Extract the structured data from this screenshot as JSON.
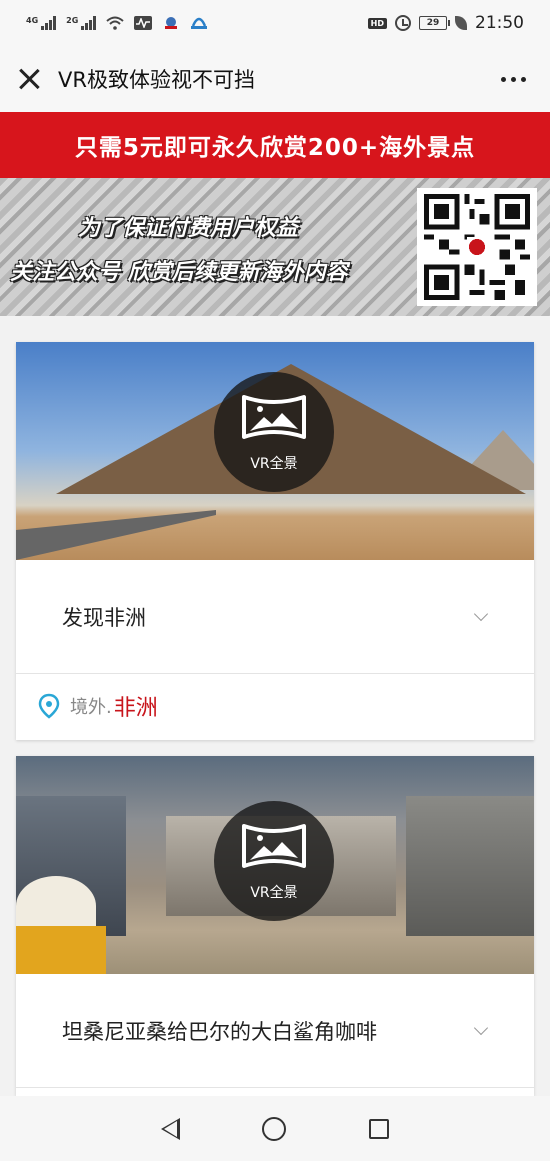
{
  "status_bar": {
    "network1": "4G",
    "network2": "2G",
    "hd": "HD",
    "battery": "29",
    "time": "21:50"
  },
  "title_bar": {
    "title": "VR极致体验视不可挡"
  },
  "promo": {
    "text": "只需5元即可永久欣赏200+海外景点"
  },
  "banner": {
    "line1": "为了保证付费用户权益",
    "line2": "关注公众号 欣赏后续更新海外内容"
  },
  "vr_badge_label": "VR全景",
  "cards": [
    {
      "title": "发现非洲",
      "loc_prefix": "境外.",
      "loc_name": "非洲"
    },
    {
      "title": "坦桑尼亚桑给巴尔的大白鲨角咖啡"
    }
  ],
  "colors": {
    "promo_red": "#d7151c",
    "location_red": "#c8141b",
    "pin_blue": "#2aa7d6"
  },
  "icons": {
    "close": "close-icon",
    "more": "more-icon",
    "vr": "vr-panorama-icon",
    "location": "location-pin-icon",
    "chevron": "chevron-down-icon",
    "nav_back": "nav-back-icon",
    "nav_home": "nav-home-icon",
    "nav_recent": "nav-recents-icon"
  }
}
